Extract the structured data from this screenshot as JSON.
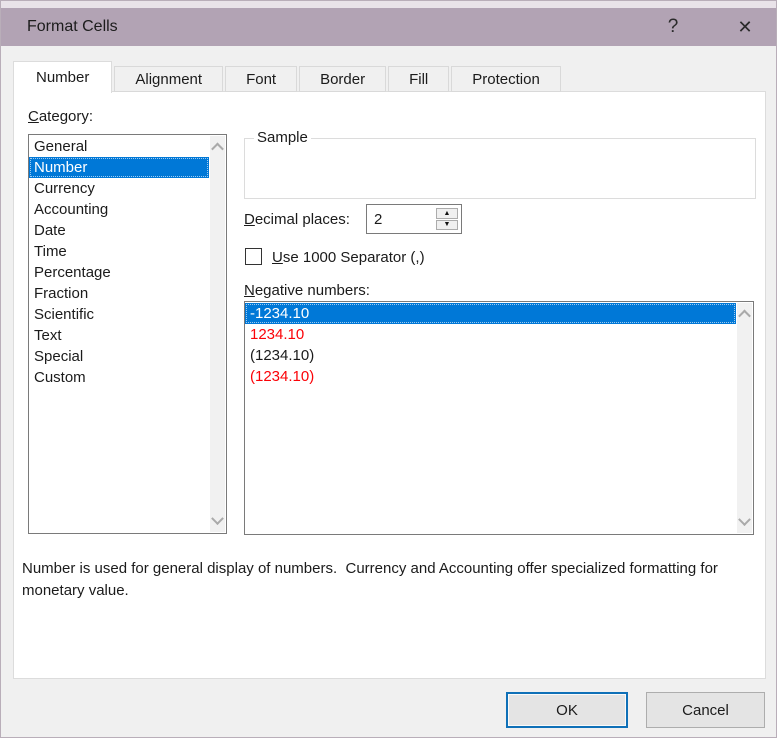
{
  "window": {
    "title": "Format Cells",
    "help_glyph": "?",
    "close_glyph": "✕"
  },
  "tabs": [
    {
      "label": "Number",
      "selected": true
    },
    {
      "label": "Alignment",
      "selected": false
    },
    {
      "label": "Font",
      "selected": false
    },
    {
      "label": "Border",
      "selected": false
    },
    {
      "label": "Fill",
      "selected": false
    },
    {
      "label": "Protection",
      "selected": false
    }
  ],
  "panel": {
    "category_label": {
      "accel": "C",
      "rest": "ategory:"
    },
    "category_items": [
      "General",
      "Number",
      "Currency",
      "Accounting",
      "Date",
      "Time",
      "Percentage",
      "Fraction",
      "Scientific",
      "Text",
      "Special",
      "Custom"
    ],
    "category_selected": "Number",
    "sample_group": {
      "label": "Sample",
      "value": ""
    },
    "decimal_places": {
      "label": {
        "accel": "D",
        "rest": "ecimal places:"
      },
      "value": "2"
    },
    "separator": {
      "label": {
        "accel": "U",
        "rest": "se 1000 Separator (,)"
      },
      "checked": false
    },
    "negative": {
      "label": {
        "accel": "N",
        "rest": "egative numbers:"
      },
      "items": [
        {
          "text": "-1234.10",
          "style": "selected"
        },
        {
          "text": "1234.10",
          "style": "red"
        },
        {
          "text": "(1234.10)",
          "style": "black"
        },
        {
          "text": "(1234.10)",
          "style": "red"
        }
      ]
    },
    "description": "Number is used for general display of numbers.  Currency and Accounting offer specialized formatting for monetary value."
  },
  "buttons": {
    "ok": "OK",
    "cancel": "Cancel"
  },
  "icons": {
    "spin_up": "▲",
    "spin_down": "▼"
  },
  "colors": {
    "accent": "#0078d7",
    "titlebar": "#b2a3b4",
    "negative_red": "#fb0207",
    "button_face": "#e4e4e4"
  }
}
